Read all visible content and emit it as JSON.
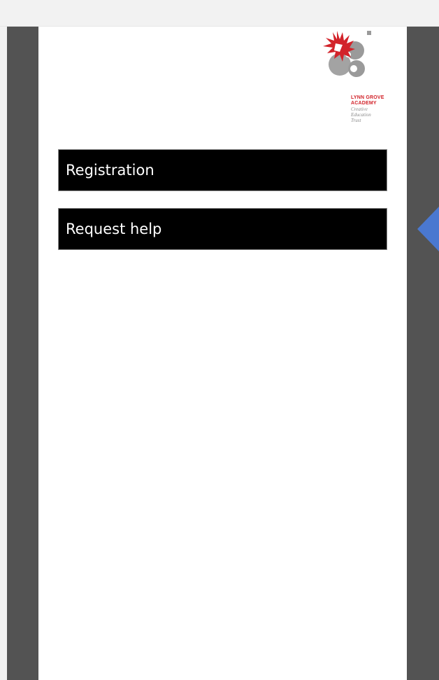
{
  "logo": {
    "line1": "LYNN GROVE",
    "line2": "ACADEMY",
    "line3": "Creative",
    "line4": "Education",
    "line5": "Trust"
  },
  "menu": {
    "items": [
      {
        "label": "Registration"
      },
      {
        "label": "Request help"
      }
    ]
  },
  "colors": {
    "side_panels": "#535353",
    "accent_arrow": "#4a78d0",
    "logo_red": "#d2232a",
    "logo_grey": "#9a9a9a",
    "button_bg": "#000000",
    "button_text": "#ffffff"
  }
}
